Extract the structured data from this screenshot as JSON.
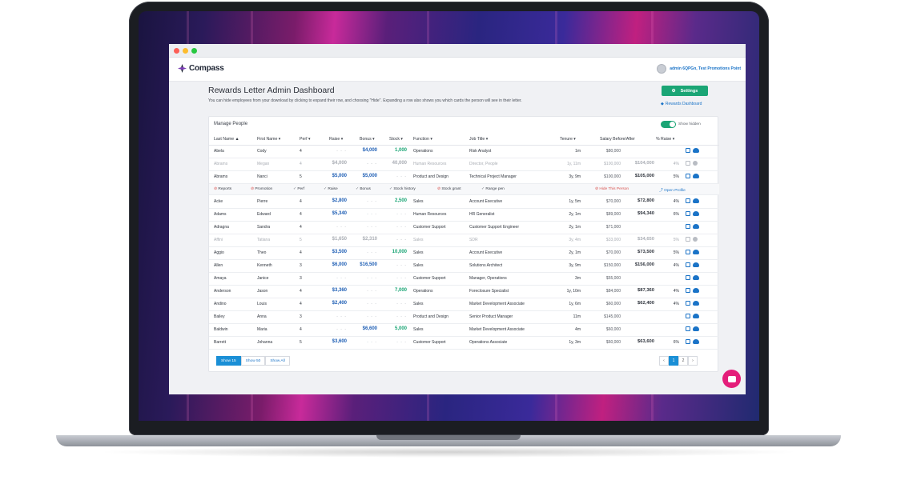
{
  "app": {
    "logo_text": "Compass",
    "user_name": "admin 6QPGn, Test Promotions Point",
    "page_title": "Rewards Letter Admin Dashboard",
    "subtitle": "You can hide employees from your download by clicking to expand their row, and choosing \"Hide\". Expanding a row also shows you which cards the person will see in their letter.",
    "settings_label": "Settings",
    "rewards_link": "Rewards Dashboard"
  },
  "panel": {
    "title": "Manage People",
    "toggle_label": "Show hidden"
  },
  "columns": {
    "last": "Last Name ▲",
    "first": "First Name ▾",
    "perf": "Perf ▾",
    "raise": "Raise ▾",
    "bonus": "Bonus ▾",
    "stock": "Stock ▾",
    "function": "Function ▾",
    "job": "Job Title ▾",
    "tenure": "Tenure ▾",
    "salary": "Salary Before/After",
    "pct": "% Raise ▾"
  },
  "rows_top": [
    {
      "last": "Abela",
      "first": "Cody",
      "perf": "4",
      "raise": "- - -",
      "bonus": "$4,000",
      "stock": "1,000",
      "function": "Operations",
      "job": "Risk Analyst",
      "tenure": "1m",
      "before": "$80,000",
      "after": "",
      "pct": "",
      "dim": false
    },
    {
      "last": "Abrams",
      "first": "Megan",
      "perf": "4",
      "raise": "$4,000",
      "bonus": "- - -",
      "stock": "40,000",
      "function": "Human Resources",
      "job": "Director, People",
      "tenure": "1y, 11m",
      "before": "$100,000",
      "after": "$104,000",
      "pct": "4%",
      "dim": true
    },
    {
      "last": "Abrams",
      "first": "Nanci",
      "perf": "5",
      "raise": "$5,000",
      "bonus": "$5,000",
      "stock": "- - -",
      "function": "Product and Design",
      "job": "Technical Project Manager",
      "tenure": "3y, 9m",
      "before": "$100,000",
      "after": "$105,000",
      "pct": "5%",
      "dim": false
    }
  ],
  "expand": {
    "reports": "Reports",
    "promotion": "Promotion",
    "perf": "Perf",
    "raise": "Raise",
    "bonus": "Bonus",
    "stock_history": "Stock history",
    "stock_grant": "Stock grant",
    "range_pen": "Range pen",
    "hide": "Hide This Person",
    "open": "Open Profile"
  },
  "rows_bottom": [
    {
      "last": "Acke",
      "first": "Pierre",
      "perf": "4",
      "raise": "$2,800",
      "bonus": "- - -",
      "stock": "2,500",
      "function": "Sales",
      "job": "Account Executive",
      "tenure": "1y, 5m",
      "before": "$70,000",
      "after": "$72,800",
      "pct": "4%",
      "dim": false
    },
    {
      "last": "Adams",
      "first": "Edward",
      "perf": "4",
      "raise": "$5,340",
      "bonus": "- - -",
      "stock": "- - -",
      "function": "Human Resources",
      "job": "HR Generalist",
      "tenure": "2y, 1m",
      "before": "$89,000",
      "after": "$94,340",
      "pct": "6%",
      "dim": false
    },
    {
      "last": "Adragna",
      "first": "Sandra",
      "perf": "4",
      "raise": "- - -",
      "bonus": "- - -",
      "stock": "- - -",
      "function": "Customer Support",
      "job": "Customer Support Engineer",
      "tenure": "2y, 1m",
      "before": "$71,000",
      "after": "",
      "pct": "",
      "dim": false
    },
    {
      "last": "Affini",
      "first": "Tatiana",
      "perf": "5",
      "raise": "$1,650",
      "bonus": "$2,310",
      "stock": "- - -",
      "function": "Sales",
      "job": "SDR",
      "tenure": "3y, 4m",
      "before": "$33,000",
      "after": "$34,650",
      "pct": "5%",
      "dim": true
    },
    {
      "last": "Aggio",
      "first": "Theo",
      "perf": "4",
      "raise": "$3,500",
      "bonus": "- - -",
      "stock": "10,000",
      "function": "Sales",
      "job": "Account Executive",
      "tenure": "2y, 1m",
      "before": "$70,000",
      "after": "$73,500",
      "pct": "5%",
      "dim": false
    },
    {
      "last": "Allen",
      "first": "Kenneth",
      "perf": "3",
      "raise": "$6,000",
      "bonus": "$16,500",
      "stock": "- - -",
      "function": "Sales",
      "job": "Solutions Architect",
      "tenure": "3y, 9m",
      "before": "$150,000",
      "after": "$156,000",
      "pct": "4%",
      "dim": false
    },
    {
      "last": "Amaya",
      "first": "Janice",
      "perf": "3",
      "raise": "- - -",
      "bonus": "- - -",
      "stock": "- - -",
      "function": "Customer Support",
      "job": "Manager, Operations",
      "tenure": "3m",
      "before": "$55,000",
      "after": "",
      "pct": "",
      "dim": false
    },
    {
      "last": "Anderson",
      "first": "Jason",
      "perf": "4",
      "raise": "$3,360",
      "bonus": "- - -",
      "stock": "7,000",
      "function": "Operations",
      "job": "Foreclosure Specialist",
      "tenure": "1y, 10m",
      "before": "$84,000",
      "after": "$87,360",
      "pct": "4%",
      "dim": false
    },
    {
      "last": "Andino",
      "first": "Louis",
      "perf": "4",
      "raise": "$2,400",
      "bonus": "- - -",
      "stock": "- - -",
      "function": "Sales",
      "job": "Market Development Associate",
      "tenure": "1y, 6m",
      "before": "$60,000",
      "after": "$62,400",
      "pct": "4%",
      "dim": false
    },
    {
      "last": "Bailey",
      "first": "Anna",
      "perf": "3",
      "raise": "- - -",
      "bonus": "- - -",
      "stock": "- - -",
      "function": "Product and Design",
      "job": "Senior Product Manager",
      "tenure": "11m",
      "before": "$145,000",
      "after": "",
      "pct": "",
      "dim": false
    },
    {
      "last": "Baldwin",
      "first": "Maria",
      "perf": "4",
      "raise": "- - -",
      "bonus": "$6,600",
      "stock": "5,000",
      "function": "Sales",
      "job": "Market Development Associate",
      "tenure": "4m",
      "before": "$60,000",
      "after": "",
      "pct": "",
      "dim": false
    },
    {
      "last": "Barrett",
      "first": "Johanna",
      "perf": "5",
      "raise": "$3,600",
      "bonus": "- - -",
      "stock": "- - -",
      "function": "Customer Support",
      "job": "Operations Associate",
      "tenure": "1y, 3m",
      "before": "$60,000",
      "after": "$63,600",
      "pct": "6%",
      "dim": false
    }
  ],
  "pager": {
    "show15": "Show 15",
    "show50": "Show 50",
    "showall": "Show All",
    "prev": "‹",
    "page1": "1",
    "page2": "2",
    "next": "›"
  },
  "colors": {
    "accent_green": "#1aa575",
    "accent_blue": "#1a73c7",
    "chat_pink": "#e41e7a"
  }
}
